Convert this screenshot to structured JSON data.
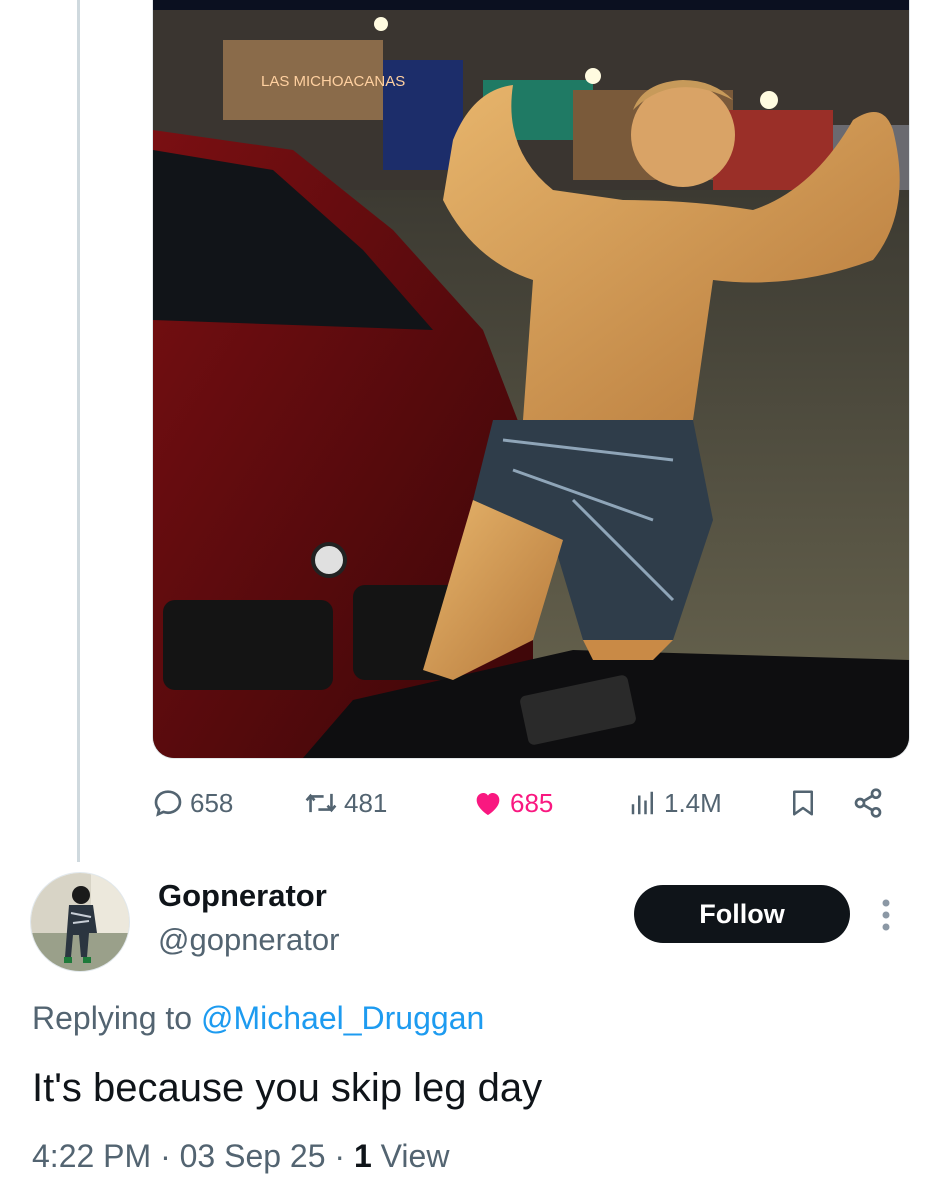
{
  "post": {
    "media": {
      "photo": "man-flexing-in-parking-lot",
      "storefront_sign": "LAS MICHOACANAS"
    },
    "actions": {
      "replies": "658",
      "reposts": "481",
      "likes": "685",
      "views": "1.4M"
    },
    "icons": [
      "reply-icon",
      "repost-icon",
      "heart-icon",
      "views-icon",
      "bookmark-icon",
      "share-icon"
    ],
    "like_color": "#f91880"
  },
  "reply": {
    "display_name": "Gopnerator",
    "handle": "@gopnerator",
    "follow_label": "Follow",
    "replying_prefix": "Replying to",
    "replying_to": "@Michael_Druggan",
    "text": "It's because you skip leg day",
    "time": "4:22 PM",
    "date": "03 Sep 25",
    "view_count": "1",
    "view_label": "View"
  },
  "colors": {
    "text_primary": "#0f1419",
    "text_secondary": "#536471",
    "link": "#1d9bf0",
    "follow_bg": "#0f1419"
  }
}
